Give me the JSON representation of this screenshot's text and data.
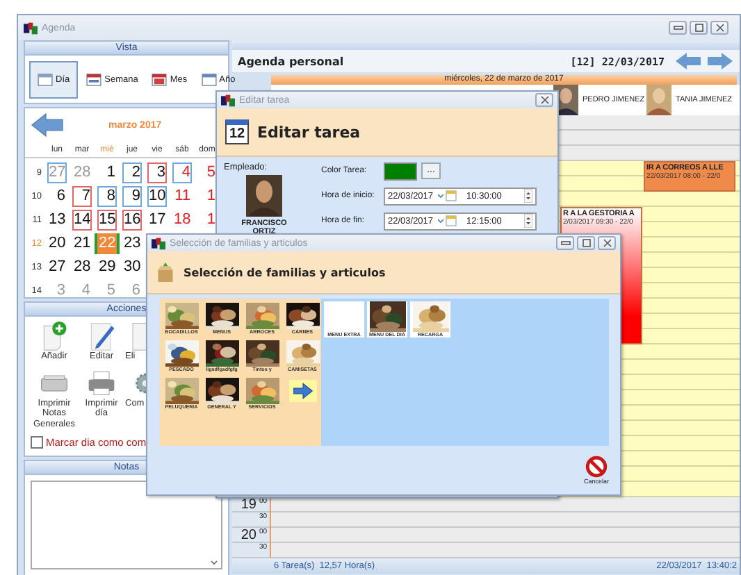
{
  "window": {
    "title": "Agenda"
  },
  "vista": {
    "title": "Vista",
    "views": [
      {
        "label": "Día",
        "kind": "day",
        "selected": true
      },
      {
        "label": "Semana",
        "kind": "week",
        "selected": false
      },
      {
        "label": "Mes",
        "kind": "month",
        "selected": false
      },
      {
        "label": "Año",
        "kind": "year",
        "selected": false
      }
    ]
  },
  "calendar": {
    "month": "marzo 2017",
    "weekdays": [
      {
        "label": "lun",
        "today": false
      },
      {
        "label": "mar",
        "today": false
      },
      {
        "label": "mié",
        "today": true
      },
      {
        "label": "jue",
        "today": false
      },
      {
        "label": "vie",
        "today": false
      },
      {
        "label": "sáb",
        "today": false
      },
      {
        "label": "dom",
        "today": false
      }
    ],
    "weeks": [
      {
        "week": "9",
        "current": false,
        "days": [
          {
            "day": "27",
            "other_month": true,
            "weekend": false,
            "selected": false,
            "color": "#6fa8dc"
          },
          {
            "day": "28",
            "other_month": true,
            "weekend": false,
            "selected": false
          },
          {
            "day": "1",
            "other_month": false,
            "weekend": false,
            "selected": false
          },
          {
            "day": "2",
            "other_month": false,
            "weekend": false,
            "selected": false,
            "color": "#6fa8dc"
          },
          {
            "day": "3",
            "other_month": false,
            "weekend": false,
            "selected": false,
            "color": "#e06666"
          },
          {
            "day": "4",
            "other_month": false,
            "weekend": true,
            "selected": false,
            "color": "#6fa8dc"
          },
          {
            "day": "5",
            "other_month": false,
            "weekend": true,
            "selected": false
          }
        ]
      },
      {
        "week": "10",
        "current": false,
        "days": [
          {
            "day": "6",
            "other_month": false,
            "weekend": false,
            "selected": false
          },
          {
            "day": "7",
            "other_month": false,
            "weekend": false,
            "selected": false,
            "color": "#e06666"
          },
          {
            "day": "8",
            "other_month": false,
            "weekend": false,
            "selected": false,
            "color": "#6fa8dc"
          },
          {
            "day": "9",
            "other_month": false,
            "weekend": false,
            "selected": false,
            "color": "#6fa8dc"
          },
          {
            "day": "10",
            "other_month": false,
            "weekend": false,
            "selected": false,
            "color": "#6fa8dc"
          },
          {
            "day": "11",
            "other_month": false,
            "weekend": true,
            "selected": false
          },
          {
            "day": "1",
            "other_month": false,
            "weekend": true,
            "selected": false
          }
        ]
      },
      {
        "week": "11",
        "current": false,
        "days": [
          {
            "day": "13",
            "other_month": false,
            "weekend": false,
            "selected": false
          },
          {
            "day": "14",
            "other_month": false,
            "weekend": false,
            "selected": false,
            "color": "#e06666"
          },
          {
            "day": "15",
            "other_month": false,
            "weekend": false,
            "selected": false,
            "color": "#e06666"
          },
          {
            "day": "16",
            "other_month": false,
            "weekend": false,
            "selected": false,
            "color": "#e06666"
          },
          {
            "day": "17",
            "other_month": false,
            "weekend": false,
            "selected": false
          },
          {
            "day": "18",
            "other_month": false,
            "weekend": true,
            "selected": false
          },
          {
            "day": "1",
            "other_month": false,
            "weekend": true,
            "selected": false
          }
        ]
      },
      {
        "week": "12",
        "current": true,
        "days": [
          {
            "day": "20",
            "other_month": false,
            "weekend": false,
            "selected": false
          },
          {
            "day": "21",
            "other_month": false,
            "weekend": false,
            "selected": false
          },
          {
            "day": "22",
            "other_month": false,
            "weekend": false,
            "selected": true
          },
          {
            "day": "23",
            "other_month": false,
            "weekend": false,
            "selected": false
          }
        ]
      },
      {
        "week": "13",
        "current": false,
        "days": [
          {
            "day": "27",
            "other_month": false,
            "weekend": false,
            "selected": false
          },
          {
            "day": "28",
            "other_month": false,
            "weekend": false,
            "selected": false
          },
          {
            "day": "29",
            "other_month": false,
            "weekend": false,
            "selected": false
          },
          {
            "day": "30",
            "other_month": false,
            "weekend": false,
            "selected": false
          }
        ]
      },
      {
        "week": "14",
        "current": false,
        "days": [
          {
            "day": "3",
            "other_month": true,
            "weekend": false,
            "selected": false
          },
          {
            "day": "4",
            "other_month": true,
            "weekend": false,
            "selected": false
          },
          {
            "day": "5",
            "other_month": true,
            "weekend": false,
            "selected": false
          },
          {
            "day": "6",
            "other_month": true,
            "weekend": false,
            "selected": false
          }
        ]
      }
    ]
  },
  "actions": {
    "title": "Acciones",
    "buttons": [
      {
        "label": "Añadir",
        "kind": "add"
      },
      {
        "label": "Editar",
        "kind": "edit"
      },
      {
        "label": "Eli",
        "kind": "delete"
      },
      {
        "label": "Imprimir Notas Generales",
        "kind": "scanner"
      },
      {
        "label": "Imprimir día",
        "kind": "printer"
      },
      {
        "label": "Com",
        "kind": "gear"
      }
    ],
    "checkbox": {
      "label": "Marcar dia como com",
      "checked": false
    }
  },
  "notes": {
    "title": "Notas"
  },
  "agenda": {
    "title": "Agenda personal",
    "week": "[12]",
    "date": "22/03/2017",
    "day_banner": "miércoles, 22 de marzo de 2017",
    "employees": [
      {
        "name": "PEDRO JIMENEZ"
      },
      {
        "name": "TANIA JIMENEZ"
      }
    ],
    "slots": [
      {
        "hour": "19",
        "minute": "00"
      },
      {
        "minute": "30"
      },
      {
        "hour": "20",
        "minute": "00"
      },
      {
        "minute": "30"
      }
    ],
    "events": [
      {
        "title": "IR A CORREOS A LLE",
        "time": "22/03/2017 08:00 - 22/0",
        "color": "#f08a4b"
      },
      {
        "title": "R A LA GESTORIA A",
        "time": "2/03/2017 09:30 - 22/0",
        "color": "#ff0000"
      }
    ]
  },
  "status_bar": {
    "summary": "6 Tarea(s)  12,57 Hora(s)",
    "datetime": "22/03/2017  13:40:2"
  },
  "edit_dialog": {
    "title": "Editar tarea",
    "icon_day": "12",
    "heading": "Editar tarea",
    "employee_label": "Empleado:",
    "employee_name": "FRANCISCO ORTIZ",
    "color_label": "Color Tarea:",
    "color": "#008000",
    "more": "...",
    "start": {
      "label": "Hora de inicio:",
      "date": "22/03/2017",
      "time": "10:30:00"
    },
    "end": {
      "label": "Hora de fin:",
      "date": "22/03/2017",
      "time": "12:15:00"
    }
  },
  "select_dialog": {
    "title": "Selección de familias y articulos",
    "heading": "Selección de familias y articulos",
    "families": [
      {
        "label": "BOCADILLOS",
        "kind": "picture"
      },
      {
        "label": "MENUS",
        "kind": "picture"
      },
      {
        "label": "ARROCES",
        "kind": "picture"
      },
      {
        "label": "CARNES",
        "kind": "picture"
      },
      {
        "label": "PESCADO",
        "kind": "picture"
      },
      {
        "label": "ligsdfgsdfgfg",
        "kind": "picture"
      },
      {
        "label": "Tintos y",
        "kind": "picture"
      },
      {
        "label": "CAMISETAS",
        "kind": "picture"
      },
      {
        "label": "PELUQUERIA",
        "kind": "picture"
      },
      {
        "label": "GENERAL Y",
        "kind": "picture"
      },
      {
        "label": "SERVICIOS",
        "kind": "picture"
      },
      {
        "kind": "next"
      }
    ],
    "articles": [
      {
        "label": "MENU EXTRA",
        "kind": "blank"
      },
      {
        "label": "MENU DEL DIA",
        "kind": "picture"
      },
      {
        "label": "RECARGA",
        "kind": "picture"
      }
    ],
    "cancel": "Cancelar"
  }
}
